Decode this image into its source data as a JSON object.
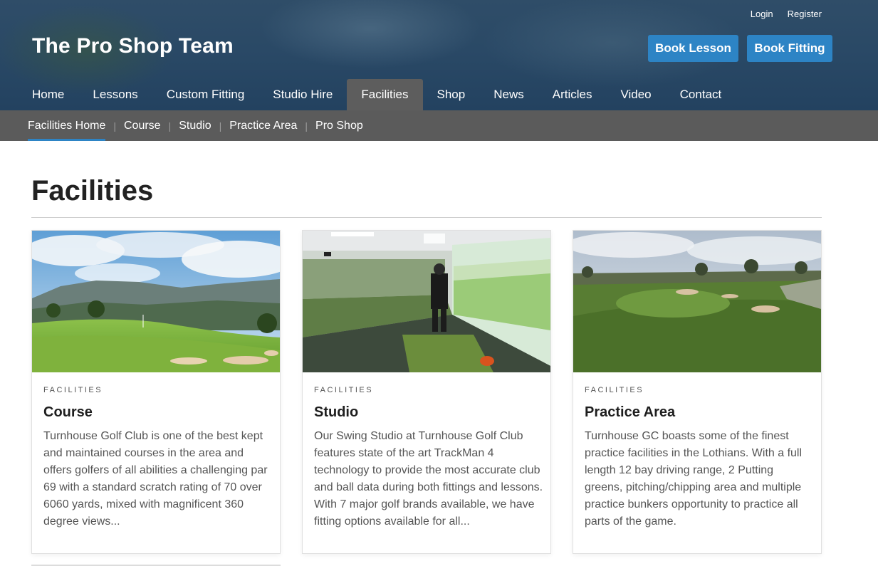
{
  "header": {
    "site_title": "The Pro Shop Team",
    "top_links": {
      "login": "Login",
      "register": "Register"
    },
    "cta": {
      "book_lesson": "Book Lesson",
      "book_fitting": "Book Fitting"
    },
    "brand_color": "#2d84c5"
  },
  "main_nav": {
    "items": [
      {
        "label": "Home"
      },
      {
        "label": "Lessons"
      },
      {
        "label": "Custom Fitting"
      },
      {
        "label": "Studio Hire"
      },
      {
        "label": "Facilities",
        "active": true
      },
      {
        "label": "Shop"
      },
      {
        "label": "News"
      },
      {
        "label": "Articles"
      },
      {
        "label": "Video"
      },
      {
        "label": "Contact"
      }
    ]
  },
  "sub_nav": {
    "items": [
      {
        "label": "Facilities Home",
        "active": true
      },
      {
        "label": "Course"
      },
      {
        "label": "Studio"
      },
      {
        "label": "Practice Area"
      },
      {
        "label": "Pro Shop"
      }
    ],
    "separator": "|"
  },
  "page": {
    "heading": "Facilities"
  },
  "cards": [
    {
      "kicker": "FACILITIES",
      "title": "Course",
      "excerpt": "Turnhouse Golf Club is one of the best kept and maintained courses in the area and offers golfers of all abilities a challenging par 69 with a standard scratch rating of 70 over 6060 yards, mixed with magnificent 360 degree views..."
    },
    {
      "kicker": "FACILITIES",
      "title": "Studio",
      "excerpt": "Our Swing Studio at Turnhouse Golf Club features state of the art TrackMan 4 technology to provide the most accurate club and ball data during both fittings and lessons. With 7 major golf brands available, we have fitting options available for all..."
    },
    {
      "kicker": "FACILITIES",
      "title": "Practice Area",
      "excerpt": "Turnhouse GC boasts some of the finest practice facilities in the Lothians. With a full length 12 bay driving range, 2 Putting greens, pitching/chipping area and multiple practice bunkers opportunity to practice all parts of the game."
    }
  ]
}
